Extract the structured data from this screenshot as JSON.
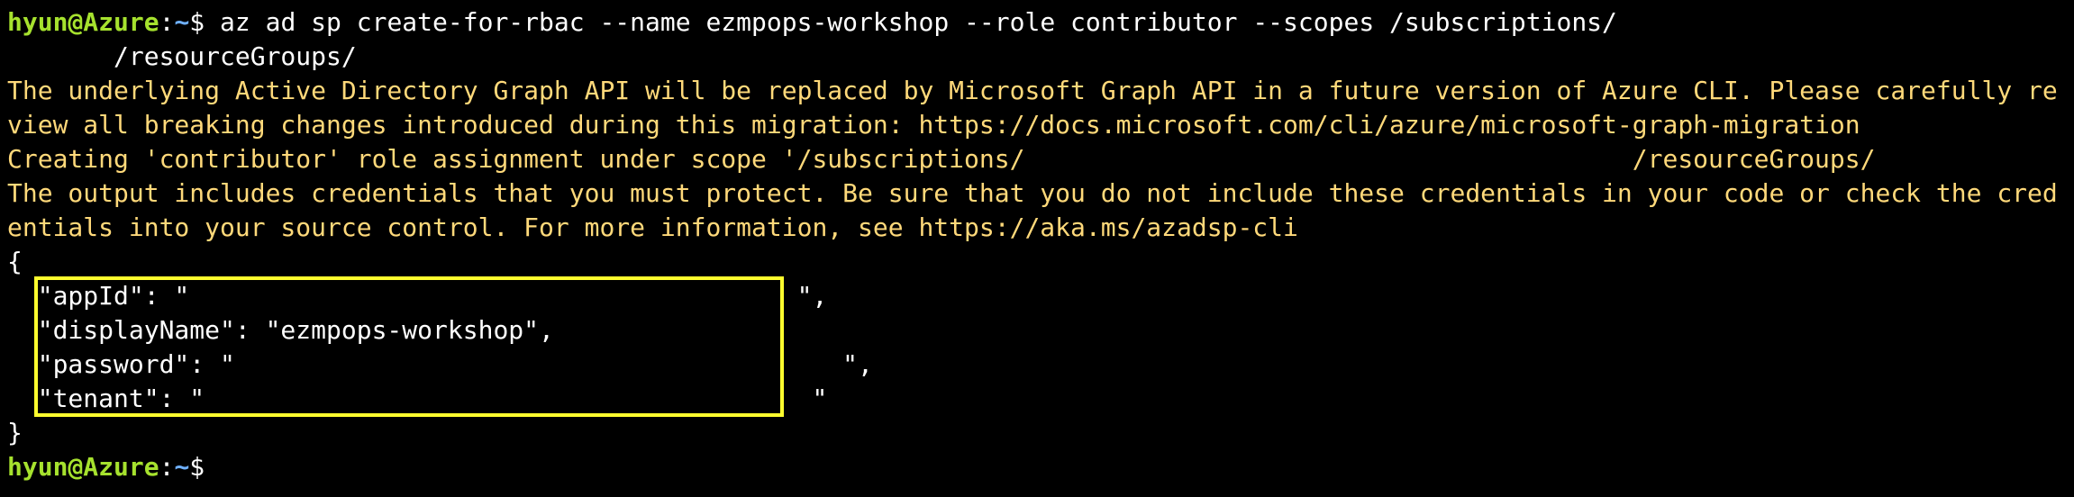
{
  "prompt": {
    "user_host": "hyun@Azure",
    "separator": ":",
    "path": "~",
    "symbol": "$"
  },
  "command": {
    "line1": " az ad sp create-for-rbac --name ezmpops-workshop --role contributor --scopes /subscriptions/",
    "line2": "       /resourceGroups/"
  },
  "warnings": {
    "graph_line1": "The underlying Active Directory Graph API will be replaced by Microsoft Graph API in a future version of Azure CLI. Please carefully re",
    "graph_line2": "view all breaking changes introduced during this migration: https://docs.microsoft.com/cli/azure/microsoft-graph-migration",
    "creating": "Creating 'contributor' role assignment under scope '/subscriptions/                                        /resourceGroups/                '",
    "output_line1": "The output includes credentials that you must protect. Be sure that you do not include these credentials in your code or check the cred",
    "output_line2": "entials into your source control. For more information, see https://aka.ms/azadsp-cli"
  },
  "json_output": {
    "open": "{",
    "appId": "  \"appId\": \"                                        \",",
    "displayName": "  \"displayName\": \"ezmpops-workshop\",",
    "password": "  \"password\": \"                                        \",",
    "tenant": "  \"tenant\": \"                                        \"",
    "close": "}"
  },
  "colors": {
    "background": "#000000",
    "user_host": "#a6e22e",
    "path": "#6fb0ff",
    "warning_text": "#ffd97a",
    "highlight_border": "#ffff2e"
  }
}
